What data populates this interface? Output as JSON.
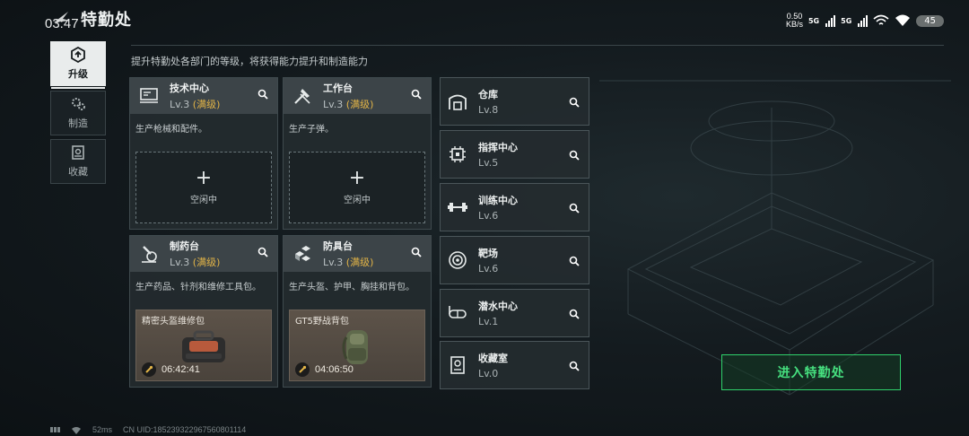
{
  "status_bar": {
    "time": "03:47",
    "net_speed_value": "0.50",
    "net_speed_unit": "KB/s",
    "sig1": "5G",
    "sig2": "5G",
    "battery": "45"
  },
  "header": {
    "title": "特勤处"
  },
  "tabs": [
    {
      "label": "升级",
      "icon": "upgrade-icon",
      "active": true
    },
    {
      "label": "制造",
      "icon": "gears-icon",
      "active": false
    },
    {
      "label": "收藏",
      "icon": "collection-icon",
      "active": false
    }
  ],
  "intro": "提升特勤处各部门的等级，将获得能力提升和制造能力",
  "level_suffix": "(满级)",
  "cards": [
    {
      "name": "技术中心",
      "level": "Lv.3",
      "desc": "生产枪械和配件。",
      "icon": "tech-center-icon",
      "slot": {
        "state": "idle",
        "label": "空闲中"
      }
    },
    {
      "name": "工作台",
      "level": "Lv.3",
      "desc": "生产子弹。",
      "icon": "workbench-icon",
      "slot": {
        "state": "idle",
        "label": "空闲中"
      }
    },
    {
      "name": "制药台",
      "level": "Lv.3",
      "desc": "生产药品、针剂和维修工具包。",
      "icon": "pharmacy-icon",
      "slot": {
        "state": "crafting",
        "item": "精密头盔维修包",
        "timer": "06:42:41"
      }
    },
    {
      "name": "防具台",
      "level": "Lv.3",
      "desc": "生产头盔、护甲、胸挂和背包。",
      "icon": "armor-bench-icon",
      "slot": {
        "state": "crafting",
        "item": "GT5野战背包",
        "timer": "04:06:50"
      }
    }
  ],
  "facilities": [
    {
      "name": "仓库",
      "level": "Lv.8",
      "icon": "warehouse-icon"
    },
    {
      "name": "指挥中心",
      "level": "Lv.5",
      "icon": "command-center-icon"
    },
    {
      "name": "训练中心",
      "level": "Lv.6",
      "icon": "training-center-icon"
    },
    {
      "name": "靶场",
      "level": "Lv.6",
      "icon": "shooting-range-icon"
    },
    {
      "name": "潜水中心",
      "level": "Lv.1",
      "icon": "diving-center-icon"
    },
    {
      "name": "收藏室",
      "level": "Lv.0",
      "icon": "collection-room-icon"
    }
  ],
  "enter_button": "进入特勤处",
  "footer": {
    "ping": "52ms",
    "uid": "CN UID:185239322967560801114"
  },
  "colors": {
    "accent_green": "#46e07f",
    "max_level": "#e2b447",
    "card_bg": "#242b2f",
    "header_bg": "#3c4448"
  }
}
